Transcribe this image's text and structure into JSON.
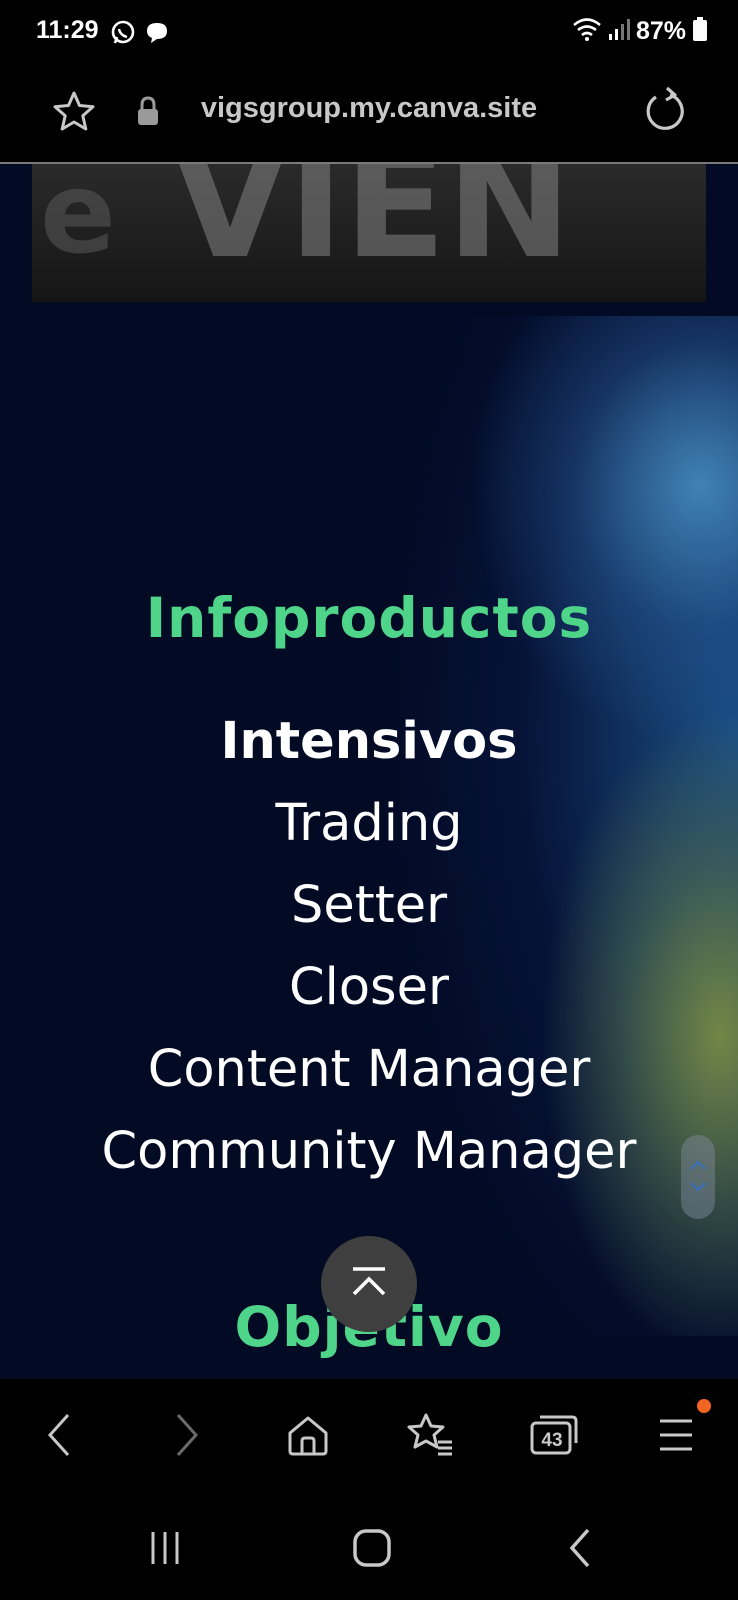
{
  "status_bar": {
    "time": "11:29",
    "battery": "87%",
    "left_icons": [
      "whatsapp-icon",
      "chat-bubble-icon"
    ],
    "right_icons": [
      "wifi-icon",
      "signal-icon",
      "battery-icon"
    ]
  },
  "address_bar": {
    "url": "vigsgroup.my.canva.site",
    "icons": [
      "bookmark-star-icon",
      "lock-icon",
      "reload-icon"
    ]
  },
  "page": {
    "section_title": "Infoproductos",
    "products": [
      "Intensivos",
      "Trading",
      "Setter",
      "Closer",
      "Content Manager",
      "Community Manager"
    ],
    "next_section_title": "Objetivo",
    "accent_color": "#4fd58a"
  },
  "browser_bar": {
    "tab_count": "43",
    "icons": [
      "back-icon",
      "forward-icon",
      "home-icon",
      "bookmarks-icon",
      "tabs-icon",
      "menu-icon"
    ],
    "notification_color": "#f26522"
  },
  "system_nav": {
    "icons": [
      "recents-icon",
      "home-button-icon",
      "back-nav-icon"
    ]
  }
}
